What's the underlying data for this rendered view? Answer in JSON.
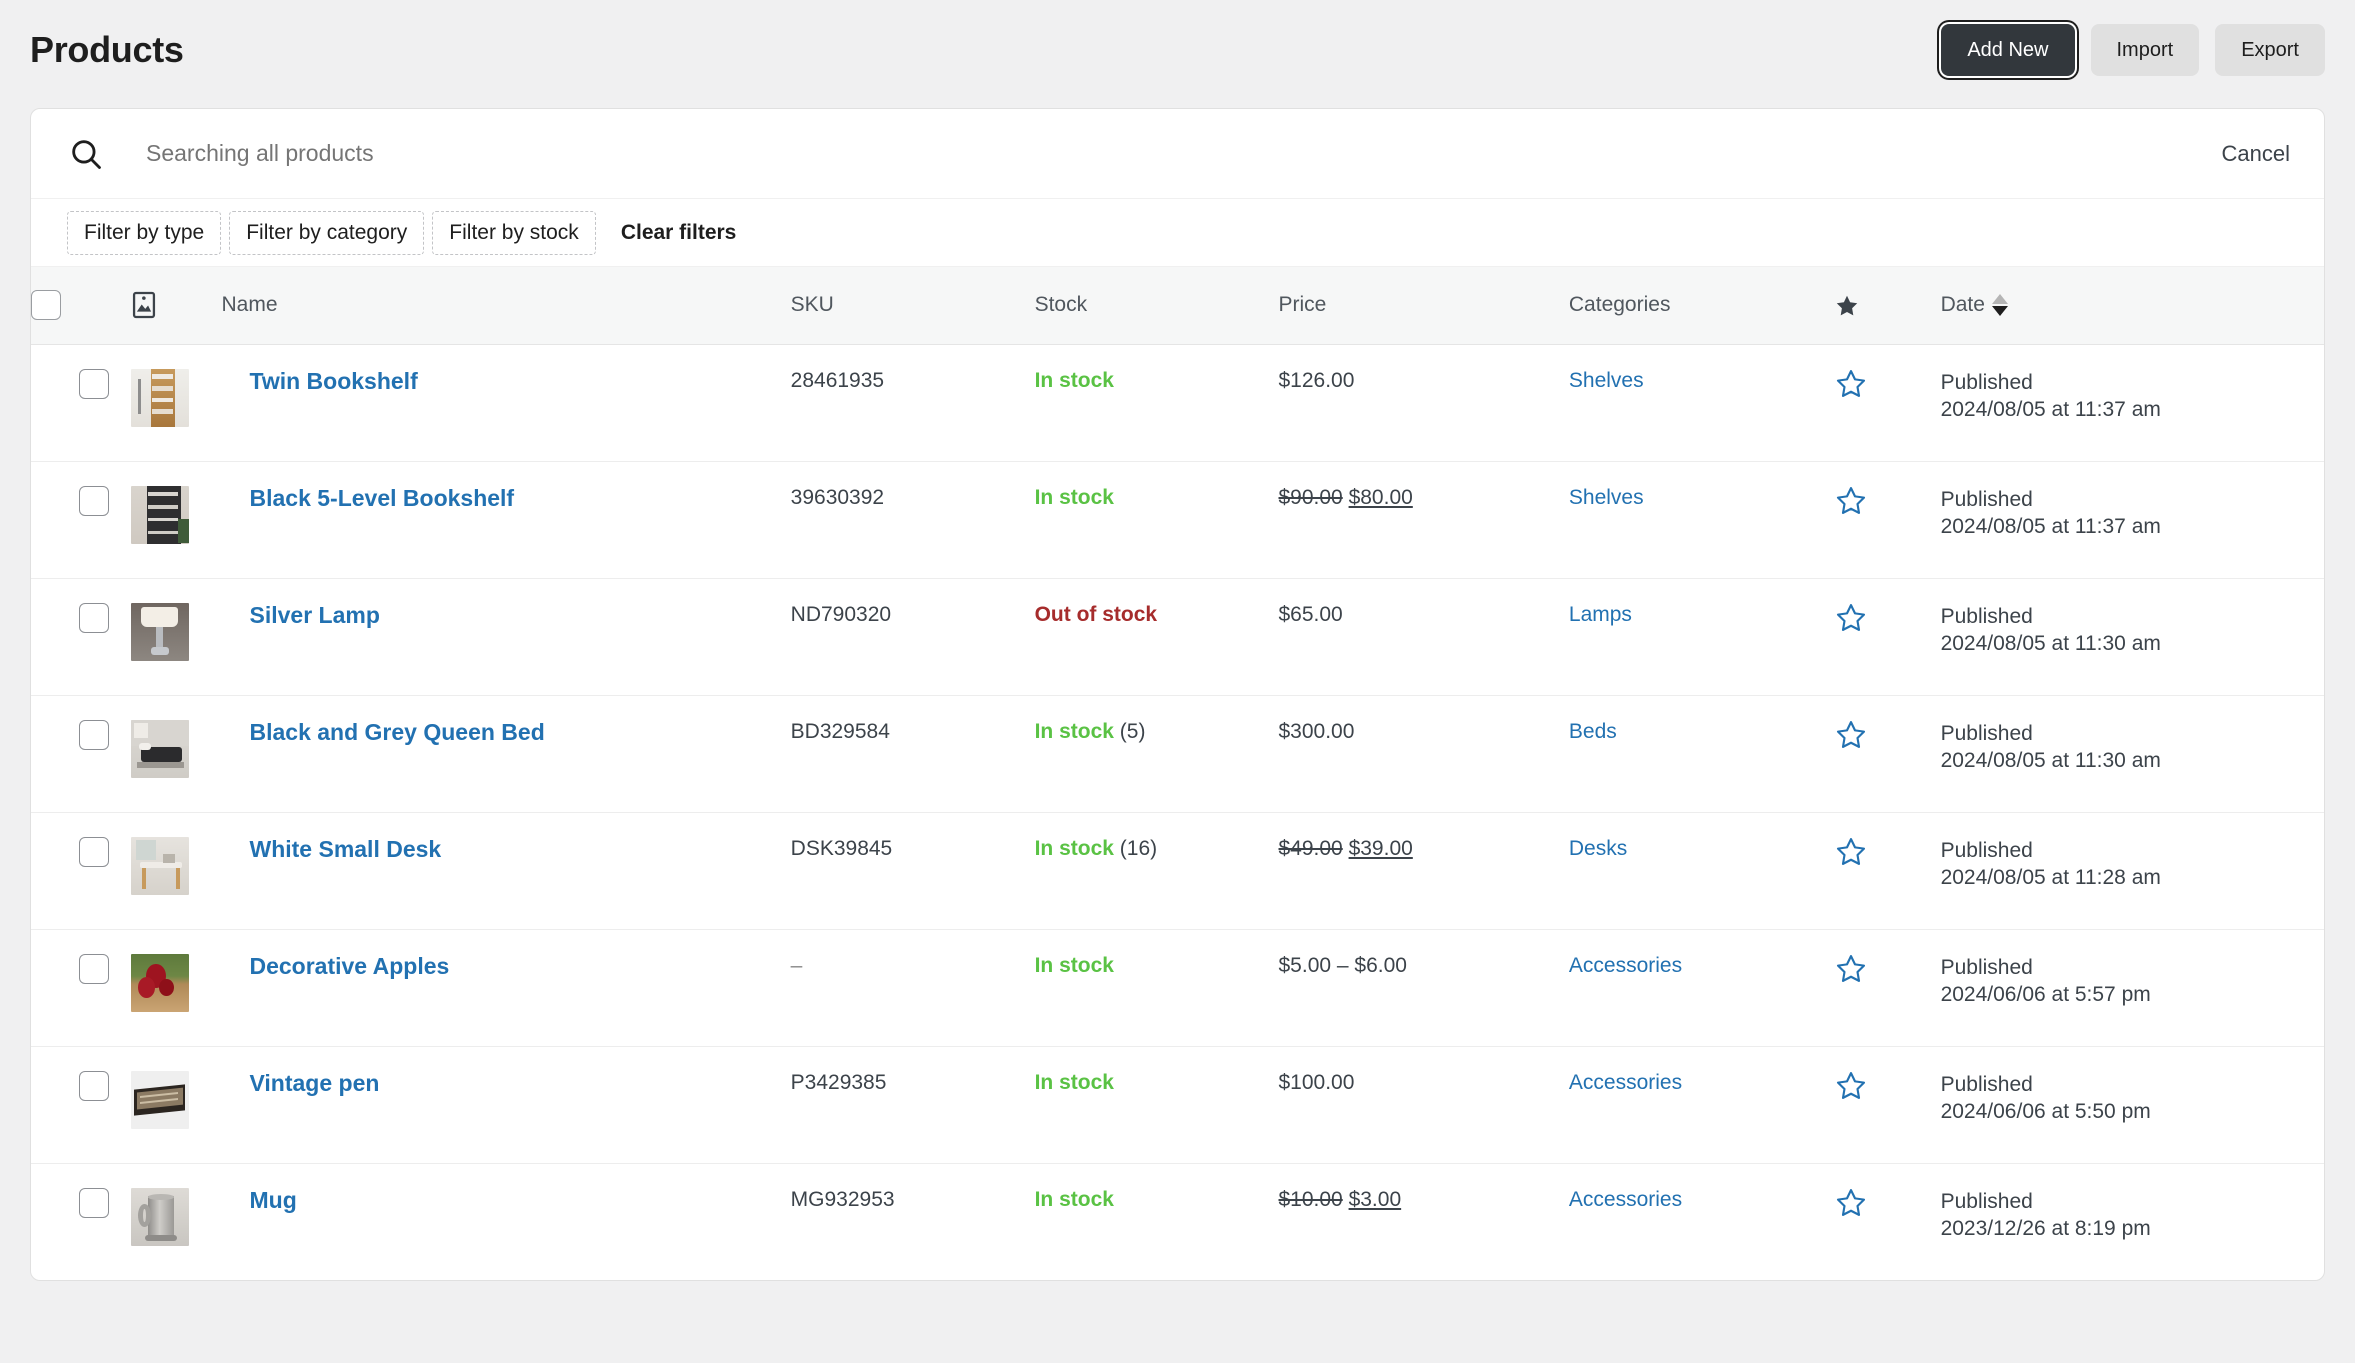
{
  "header": {
    "title": "Products",
    "buttons": [
      {
        "label": "Add New",
        "name": "add-new-button",
        "style": "primary"
      },
      {
        "label": "Import",
        "name": "import-button",
        "style": "secondary"
      },
      {
        "label": "Export",
        "name": "export-button",
        "style": "secondary"
      }
    ]
  },
  "search": {
    "placeholder": "Searching all products",
    "value": "",
    "cancel_label": "Cancel",
    "icon": "search-icon"
  },
  "filters": [
    {
      "label": "Filter by type",
      "name": "filter-by-type-chip",
      "strong": false
    },
    {
      "label": "Filter by category",
      "name": "filter-by-category-chip",
      "strong": false
    },
    {
      "label": "Filter by stock",
      "name": "filter-by-stock-chip",
      "strong": false
    },
    {
      "label": "Clear filters",
      "name": "clear-filters-chip",
      "strong": true
    }
  ],
  "table": {
    "columns": {
      "select": "",
      "image": "image-icon",
      "name": "Name",
      "sku": "SKU",
      "stock": "Stock",
      "price": "Price",
      "categories": "Categories",
      "featured": "star-icon",
      "date": "Date"
    },
    "sort": {
      "column": "Date",
      "direction": "desc"
    },
    "rows": [
      {
        "name": "Twin Bookshelf",
        "sku": "28461935",
        "stock_status": "In stock",
        "stock_count": "",
        "price": "$126.00",
        "price_old": "",
        "price_new": "",
        "category": "Shelves",
        "featured": false,
        "date_status": "Published",
        "date_value": "2024/08/05 at 11:37 am",
        "thumb": "bookshelf-wood"
      },
      {
        "name": "Black 5-Level Bookshelf",
        "sku": "39630392",
        "stock_status": "In stock",
        "stock_count": "",
        "price": "",
        "price_old": "$90.00",
        "price_new": "$80.00",
        "category": "Shelves",
        "featured": false,
        "date_status": "Published",
        "date_value": "2024/08/05 at 11:37 am",
        "thumb": "bookshelf-black"
      },
      {
        "name": "Silver Lamp",
        "sku": "ND790320",
        "stock_status": "Out of stock",
        "stock_count": "",
        "price": "$65.00",
        "price_old": "",
        "price_new": "",
        "category": "Lamps",
        "featured": false,
        "date_status": "Published",
        "date_value": "2024/08/05 at 11:30 am",
        "thumb": "lamp-silver"
      },
      {
        "name": "Black and Grey Queen Bed",
        "sku": "BD329584",
        "stock_status": "In stock",
        "stock_count": "(5)",
        "price": "$300.00",
        "price_old": "",
        "price_new": "",
        "category": "Beds",
        "featured": false,
        "date_status": "Published",
        "date_value": "2024/08/05 at 11:30 am",
        "thumb": "bed-grey"
      },
      {
        "name": "White Small Desk",
        "sku": "DSK39845",
        "stock_status": "In stock",
        "stock_count": "(16)",
        "price": "",
        "price_old": "$49.00",
        "price_new": "$39.00",
        "category": "Desks",
        "featured": false,
        "date_status": "Published",
        "date_value": "2024/08/05 at 11:28 am",
        "thumb": "desk-white"
      },
      {
        "name": "Decorative Apples",
        "sku": "–",
        "stock_status": "In stock",
        "stock_count": "",
        "price": "$5.00 – $6.00",
        "price_old": "",
        "price_new": "",
        "category": "Accessories",
        "featured": false,
        "date_status": "Published",
        "date_value": "2024/06/06 at 5:57 pm",
        "thumb": "apples-red"
      },
      {
        "name": "Vintage pen",
        "sku": "P3429385",
        "stock_status": "In stock",
        "stock_count": "",
        "price": "$100.00",
        "price_old": "",
        "price_new": "",
        "category": "Accessories",
        "featured": false,
        "date_status": "Published",
        "date_value": "2024/06/06 at 5:50 pm",
        "thumb": "pen-box"
      },
      {
        "name": "Mug",
        "sku": "MG932953",
        "stock_status": "In stock",
        "stock_count": "",
        "price": "",
        "price_old": "$10.00",
        "price_new": "$3.00",
        "category": "Accessories",
        "featured": false,
        "date_status": "Published",
        "date_value": "2023/12/26 at 8:19 pm",
        "thumb": "mug-pewter"
      }
    ]
  },
  "colors": {
    "link": "#2271b1",
    "in_stock": "#5ac244",
    "out_of_stock": "#a62c2c",
    "primary_button_bg": "#32373c",
    "secondary_button_bg": "#e0e0e0",
    "page_bg": "#f0f0f1",
    "header_bg": "#f6f7f7"
  }
}
